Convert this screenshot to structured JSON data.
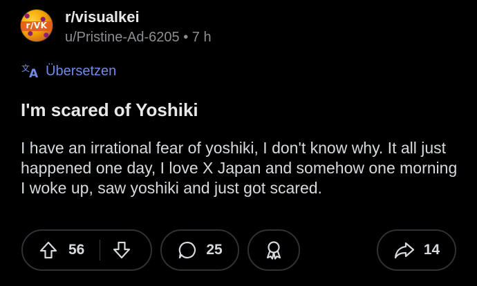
{
  "post": {
    "subreddit": "r/visualkei",
    "author": "u/Pristine-Ad-6205",
    "separator": "•",
    "age": "7 h",
    "avatar_text": "r/VK",
    "translate_label": "Übersetzen",
    "title": "I'm scared of Yoshiki",
    "body": "I have an irrational fear of yoshiki, I don't know why. It all just happened one day, I love X Japan and somehow one morning I woke up, saw yoshiki and just got scared."
  },
  "actions": {
    "upvotes": "56",
    "comments": "25",
    "shares": "14"
  },
  "icons": {
    "translate": "translate-icon",
    "upvote": "arrow-up-icon",
    "downvote": "arrow-down-icon",
    "comment": "comment-bubble-icon",
    "award": "award-ribbon-icon",
    "share": "share-arrow-icon"
  },
  "colors": {
    "background": "#000000",
    "accent_link": "#6f8ae8",
    "muted": "#8c8f92",
    "text": "#d7dadc"
  }
}
